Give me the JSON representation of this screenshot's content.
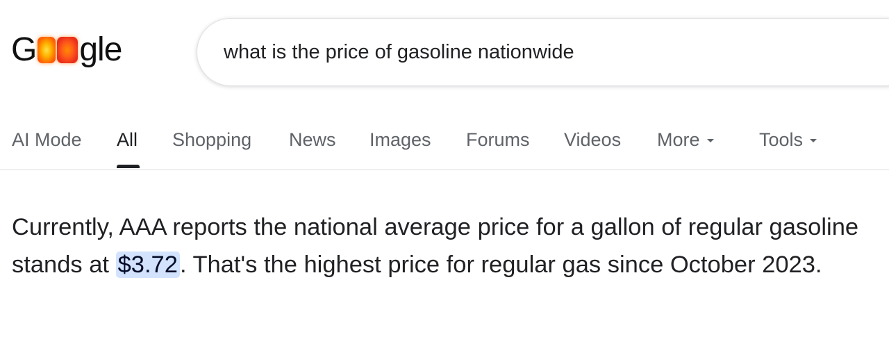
{
  "logo": {
    "prefix": "G",
    "suffix": "gle",
    "doodle_icon": "flaming-oo-doodle-icon"
  },
  "search": {
    "query": "what is the price of gasoline nationwide"
  },
  "tabs": [
    {
      "label": "AI Mode",
      "active": false
    },
    {
      "label": "All",
      "active": true
    },
    {
      "label": "Shopping",
      "active": false
    },
    {
      "label": "News",
      "active": false
    },
    {
      "label": "Images",
      "active": false
    },
    {
      "label": "Forums",
      "active": false
    },
    {
      "label": "Videos",
      "active": false
    },
    {
      "label": "More",
      "active": false,
      "icon": "caret-down-icon"
    },
    {
      "label": "Tools",
      "active": false,
      "icon": "caret-down-icon"
    }
  ],
  "answer": {
    "before": "Currently, AAA reports the national average price for a gallon of regular gasoline stands at ",
    "highlight": "$3.72",
    "after": ". That's the highest price for regular gas since October 2023."
  },
  "colors": {
    "highlight_bg": "#d3e3fd",
    "active_tab": "#202124",
    "inactive_tab": "#5f6368"
  }
}
